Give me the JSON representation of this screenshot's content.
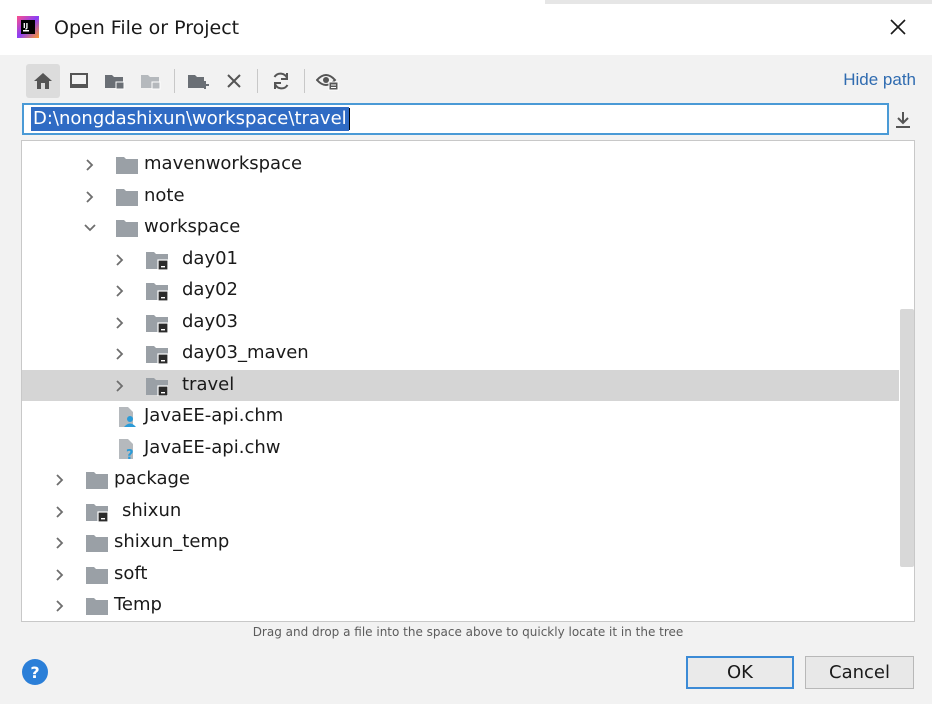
{
  "window": {
    "title": "Open File or Project",
    "close_icon": "close-icon"
  },
  "toolbar": {
    "buttons": [
      {
        "name": "home-icon",
        "active": true
      },
      {
        "name": "desktop-icon",
        "active": false
      },
      {
        "name": "project-folder-icon",
        "active": false
      },
      {
        "name": "module-folder-icon",
        "active": false
      },
      {
        "name": "new-folder-icon",
        "active": false
      },
      {
        "name": "delete-icon",
        "active": false
      },
      {
        "name": "refresh-icon",
        "active": false
      },
      {
        "name": "show-hidden-icon",
        "active": false
      }
    ],
    "hide_path_label": "Hide path"
  },
  "path": {
    "value": "D:\\nongdashixun\\workspace\\travel",
    "download_icon": "download-icon"
  },
  "tree": {
    "partial_top_row": "",
    "rows": [
      {
        "label": "mavenworkspace",
        "depth": 2,
        "kind": "folder",
        "expanded": false,
        "selected": false
      },
      {
        "label": "note",
        "depth": 2,
        "kind": "folder",
        "expanded": false,
        "selected": false
      },
      {
        "label": "workspace",
        "depth": 2,
        "kind": "folder",
        "expanded": true,
        "selected": false
      },
      {
        "label": "day01",
        "depth": 3,
        "kind": "module",
        "expanded": false,
        "selected": false
      },
      {
        "label": "day02",
        "depth": 3,
        "kind": "module",
        "expanded": false,
        "selected": false
      },
      {
        "label": "day03",
        "depth": 3,
        "kind": "module",
        "expanded": false,
        "selected": false
      },
      {
        "label": "day03_maven",
        "depth": 3,
        "kind": "module",
        "expanded": false,
        "selected": false
      },
      {
        "label": "travel",
        "depth": 3,
        "kind": "module",
        "expanded": false,
        "selected": true
      },
      {
        "label": "JavaEE-api.chm",
        "depth": 2,
        "kind": "file-chm",
        "expanded": null,
        "selected": false
      },
      {
        "label": "JavaEE-api.chw",
        "depth": 2,
        "kind": "file-unknown",
        "expanded": null,
        "selected": false
      },
      {
        "label": "package",
        "depth": 1,
        "kind": "folder",
        "expanded": false,
        "selected": false
      },
      {
        "label": "shixun",
        "depth": 1,
        "kind": "module",
        "expanded": false,
        "selected": false
      },
      {
        "label": "shixun_temp",
        "depth": 1,
        "kind": "folder",
        "expanded": false,
        "selected": false
      },
      {
        "label": "soft",
        "depth": 1,
        "kind": "folder",
        "expanded": false,
        "selected": false
      },
      {
        "label": "Temp",
        "depth": 1,
        "kind": "folder",
        "expanded": false,
        "selected": false
      }
    ]
  },
  "hint": "Drag and drop a file into the space above to quickly locate it in the tree",
  "buttons": {
    "help_label": "?",
    "ok_label": "OK",
    "cancel_label": "Cancel"
  },
  "colors": {
    "accent": "#2f6bc4",
    "link": "#2f6bb0",
    "selection": "#d5d5d5",
    "folder": "#9aa0a6",
    "help": "#2b7fd8"
  }
}
